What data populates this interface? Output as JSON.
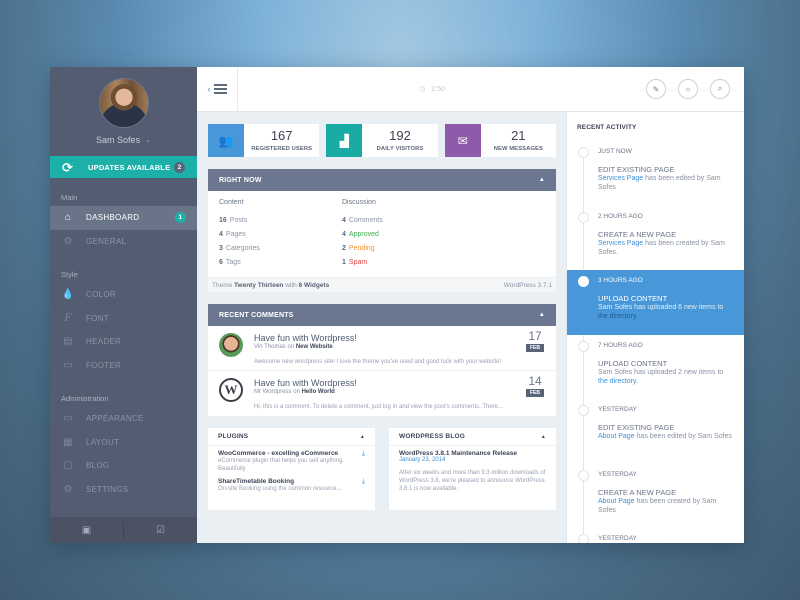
{
  "sidebar": {
    "profile": {
      "name": "Sam Sofes",
      "avatar_alt": "user-avatar"
    },
    "updates": {
      "label": "UPDATES AVAILABLE",
      "count": "2",
      "icon": "refresh-icon"
    },
    "sections": [
      {
        "label": "Main",
        "items": [
          {
            "label": "DASHBOARD",
            "icon": "home-icon",
            "active": true,
            "badge": "1"
          },
          {
            "label": "GENERAL",
            "icon": "gear-icon"
          }
        ]
      },
      {
        "label": "Style",
        "items": [
          {
            "label": "COLOR",
            "icon": "droplet-icon"
          },
          {
            "label": "FONT",
            "icon": "font-icon"
          },
          {
            "label": "HEADER",
            "icon": "header-icon"
          },
          {
            "label": "FOOTER",
            "icon": "footer-icon"
          }
        ]
      },
      {
        "label": "Administration",
        "items": [
          {
            "label": "APPEARANCE",
            "icon": "monitor-icon"
          },
          {
            "label": "LAYOUT",
            "icon": "layout-icon"
          },
          {
            "label": "BLOG",
            "icon": "comment-icon"
          },
          {
            "label": "SETTINGS",
            "icon": "gear-icon"
          }
        ]
      }
    ],
    "bottom": [
      {
        "icon": "contact-icon"
      },
      {
        "icon": "calendar-check-icon"
      }
    ]
  },
  "topbar": {
    "time": "2:50",
    "actions": [
      {
        "icon": "edit-icon"
      },
      {
        "icon": "chat-icon"
      },
      {
        "icon": "search-icon"
      }
    ]
  },
  "stats": [
    {
      "value": "167",
      "label": "REGISTERED USERS",
      "icon": "users-icon",
      "color": "#4897d8"
    },
    {
      "value": "192",
      "label": "DAILY VISITORS",
      "icon": "bar-chart-icon",
      "color": "#1aaba4"
    },
    {
      "value": "21",
      "label": "NEW MESSAGES",
      "icon": "envelope-icon",
      "color": "#8e5aa9"
    }
  ],
  "right_now": {
    "title": "RIGHT NOW",
    "content": {
      "heading": "Content",
      "rows": [
        {
          "num": "16",
          "label": "Posts"
        },
        {
          "num": "4",
          "label": "Pages"
        },
        {
          "num": "3",
          "label": "Categories"
        },
        {
          "num": "6",
          "label": "Tags"
        }
      ]
    },
    "discussion": {
      "heading": "Discussion",
      "rows": [
        {
          "num": "4",
          "label": "Comments"
        },
        {
          "num": "4",
          "label": "Approved"
        },
        {
          "num": "2",
          "label": "Pending"
        },
        {
          "num": "1",
          "label": "Spam"
        }
      ]
    },
    "footer": {
      "theme_prefix": "Theme",
      "theme": "Twenty Thirteen",
      "with": "with",
      "widgets": "6 Widgets",
      "version": "WordPress 3.7.1"
    }
  },
  "recent_comments": {
    "title": "RECENT COMMENTS",
    "items": [
      {
        "title": "Have fun with Wordpress!",
        "author": "Vin Thomas",
        "on": "on",
        "post": "New Website",
        "text": "Awesome new wordpress site!  I love the theme you've used and good luck with your website!",
        "day": "17",
        "month": "FEB"
      },
      {
        "title": "Have fun with Wordpress!",
        "author": "Mr Wordpress",
        "on": "on",
        "post": "Hello World",
        "text": "Hi, this is a comment. To delete a comment, just log in and view the post's comments. There...",
        "day": "14",
        "month": "FEB"
      }
    ]
  },
  "plugins": {
    "title": "PLUGINS",
    "items": [
      {
        "name": "WooCommerce - excelling eCommerce",
        "desc": "eCommerce plugin that helps you sell anything. Beautifully"
      },
      {
        "name": "ShareTimetable Booking",
        "desc": "On-site Booking using the common resource..."
      }
    ]
  },
  "blog": {
    "title": "WORDPRESS BLOG",
    "post_title": "WordPress 3.8.1 Maintenance Release",
    "date": "January 23, 2014",
    "excerpt": "After six weeks and more than 9.3 million downloads of WordPress 3.8, we're pleased to announce WordPress 3.8.1 is now available."
  },
  "activity": {
    "title": "RECENT ACTIVITY",
    "items": [
      {
        "time": "JUST NOW",
        "heading": "EDIT EXISTING PAGE",
        "link": "Services Page",
        "rest": " has been edited by Sam Sofes"
      },
      {
        "time": "2 HOURS AGO",
        "heading": "CREATE A NEW PAGE",
        "link": "Services Page",
        "rest": " has been created by Sam Sofes."
      },
      {
        "time": "3 HOURS AGO",
        "heading": "UPLOAD CONTENT",
        "pre": "Sam Sofes has uploaded 6 new items to ",
        "link": "the directory.",
        "highlighted": true
      },
      {
        "time": "7 HOURS AGO",
        "heading": "UPLOAD CONTENT",
        "pre": "Sam Sofes has uploaded 2 new items to ",
        "link": "the directory."
      },
      {
        "time": "YESTERDAY",
        "heading": "EDIT EXISTING PAGE",
        "link": "About Page",
        "rest": " has been edited by Sam Sofes"
      },
      {
        "time": "YESTERDAY",
        "heading": "CREATE A NEW PAGE",
        "link": "About Page",
        "rest": " has been created by Sam Sofes"
      },
      {
        "time": "YESTERDAY",
        "heading": "",
        "link": "",
        "rest": ""
      }
    ]
  }
}
